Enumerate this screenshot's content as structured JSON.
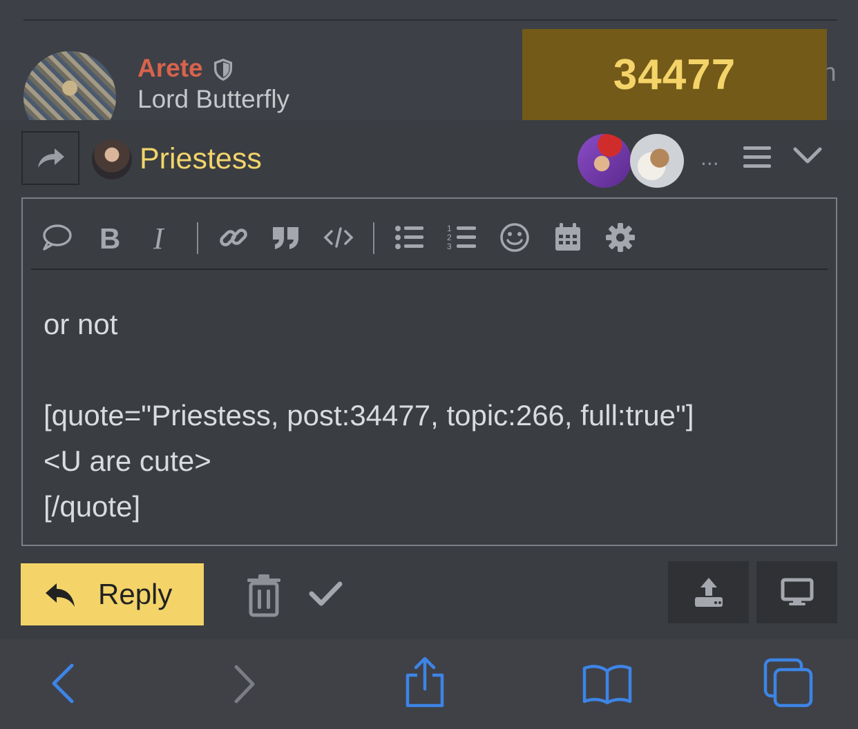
{
  "post": {
    "author": "Arete",
    "subtitle": "Lord Butterfly",
    "trailing_text": "n",
    "number_badge": "34477"
  },
  "composer": {
    "reply_target": "Priestess",
    "more": "...",
    "editor_lines": [
      "or not",
      "",
      "[quote=\"Priestess, post:34477, topic:266, full:true\"]",
      "<U are cute>",
      "[/quote]"
    ],
    "reply_label": "Reply"
  },
  "colors": {
    "author": "#d9634d",
    "accent": "#f4d469",
    "badge_bg": "#735a18",
    "browser_icon": "#3d84e6"
  },
  "icons": {
    "toolbar": [
      "speech-bubble",
      "bold",
      "italic",
      "link",
      "quote",
      "code",
      "bulleted-list",
      "numbered-list",
      "emoji",
      "calendar",
      "gear"
    ],
    "browser": [
      "back",
      "forward",
      "share",
      "bookmarks",
      "tabs"
    ]
  }
}
